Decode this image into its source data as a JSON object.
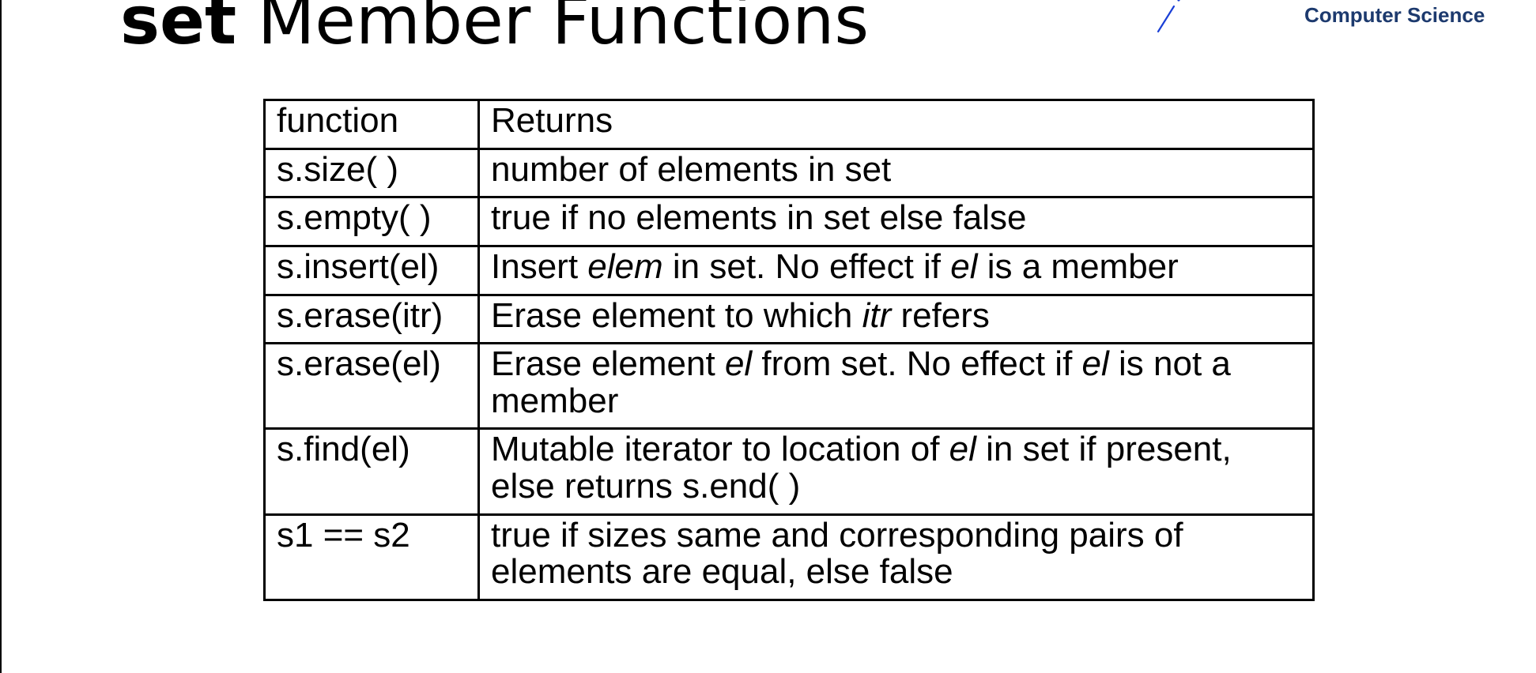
{
  "slide": {
    "title_keyword": "set",
    "title_rest": " Member Functions"
  },
  "logo": {
    "text": "Computer Science",
    "color": "#1d3a6e",
    "accent_color": "#1a3fd6",
    "icon": "slash-stroke-icon"
  },
  "table": {
    "header": {
      "function": "function",
      "returns": "Returns"
    },
    "rows": [
      {
        "function": "s.size( )",
        "returns": [
          {
            "t": "number of elements in set"
          }
        ]
      },
      {
        "function": "s.empty( )",
        "returns": [
          {
            "t": "true if no elements in set else false"
          }
        ]
      },
      {
        "function": "s.insert(el)",
        "returns": [
          {
            "t": "Insert "
          },
          {
            "t": "elem",
            "i": true
          },
          {
            "t": " in set. No effect if "
          },
          {
            "t": "el",
            "i": true
          },
          {
            "t": " is a member"
          }
        ]
      },
      {
        "function": "s.erase(itr)",
        "returns": [
          {
            "t": "Erase element to which "
          },
          {
            "t": "itr",
            "i": true
          },
          {
            "t": " refers"
          }
        ]
      },
      {
        "function": "s.erase(el)",
        "returns": [
          {
            "t": "Erase element "
          },
          {
            "t": "el",
            "i": true
          },
          {
            "t": " from set. No effect if "
          },
          {
            "t": "el",
            "i": true
          },
          {
            "t": " is not a member"
          }
        ]
      },
      {
        "function": "s.find(el)",
        "returns": [
          {
            "t": "Mutable iterator to location of "
          },
          {
            "t": "el",
            "i": true
          },
          {
            "t": " in set if present, else returns s.end( )"
          }
        ]
      },
      {
        "function": "s1 == s2",
        "returns": [
          {
            "t": "true if sizes same and corresponding pairs of elements are equal, else false"
          }
        ]
      }
    ]
  }
}
